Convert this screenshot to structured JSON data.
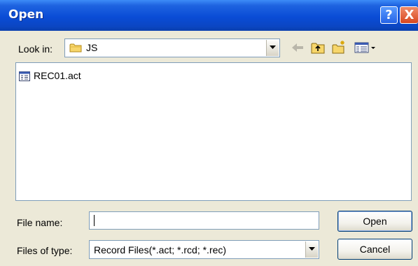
{
  "window": {
    "title": "Open",
    "help_glyph": "?",
    "close_glyph": "X"
  },
  "lookin": {
    "label": "Look in:",
    "value": "JS",
    "icon": "folder-icon"
  },
  "toolbar": {
    "icons": [
      "back-arrow-icon",
      "up-folder-icon",
      "new-folder-icon",
      "views-menu-icon"
    ]
  },
  "files": [
    {
      "name": "REC01.act",
      "icon": "record-file-icon"
    }
  ],
  "filename": {
    "label": "File name:",
    "value": ""
  },
  "filetype": {
    "label": "Files of type:",
    "value": "Record Files(*.act; *.rcd; *.rec)"
  },
  "buttons": {
    "open": "Open",
    "cancel": "Cancel"
  },
  "colors": {
    "titlebar": "#0a4cd6",
    "dialog_bg": "#ece9d8",
    "close": "#d8461e"
  }
}
